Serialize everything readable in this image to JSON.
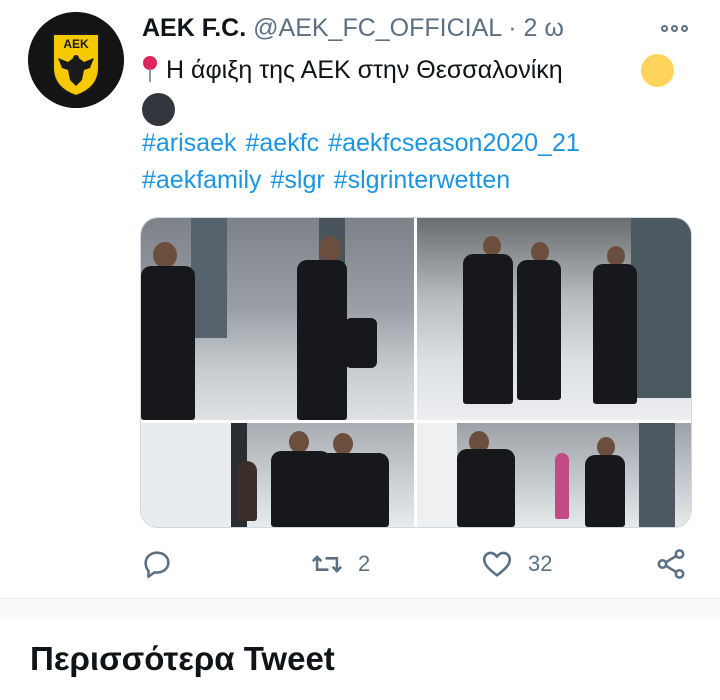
{
  "tweet": {
    "author_name": "AEK F.C.",
    "handle": "@AEK_FC_OFFICIAL",
    "separator": "·",
    "time": "2 ω",
    "avatar_label": "ΑΕΚ",
    "text": "Η άφιξη της ΑΕΚ στην Θεσσαλονίκη",
    "emoji": [
      "round-pushpin-icon",
      "yellow-circle-icon",
      "black-circle-icon"
    ],
    "hashtags_line1": [
      "#arisaek",
      "#aekfc",
      "#aekfcseason2020_21"
    ],
    "hashtags_line2": [
      "#aekfamily",
      "#slgr",
      "#slgrinterwetten"
    ],
    "photo_count": 4,
    "actions": {
      "reply_count": "",
      "retweet_count": "2",
      "like_count": "32"
    }
  },
  "section": {
    "more_tweets_title": "Περισσότερα Tweet"
  },
  "colors": {
    "link": "#1b95e0",
    "secondary_text": "#5b7083",
    "primary_text": "#0f1419",
    "avatar_gold": "#f6c900"
  }
}
